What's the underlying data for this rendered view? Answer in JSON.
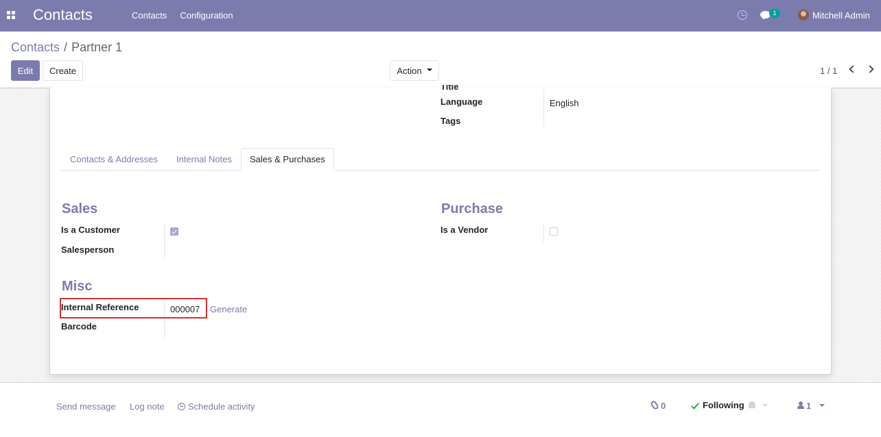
{
  "app": {
    "title": "Contacts"
  },
  "nav": {
    "menu": [
      "Contacts",
      "Configuration"
    ],
    "chat_badge": "1",
    "user_name": "Mitchell Admin"
  },
  "breadcrumb": {
    "parent": "Contacts",
    "separator": "/",
    "current": "Partner 1"
  },
  "toolbar": {
    "edit_label": "Edit",
    "create_label": "Create",
    "action_label": "Action"
  },
  "pager": {
    "value": "1 / 1"
  },
  "top_fields": [
    {
      "label": "Title",
      "value": ""
    },
    {
      "label": "Language",
      "value": "English"
    },
    {
      "label": "Tags",
      "value": ""
    }
  ],
  "tabs": [
    {
      "label": "Contacts & Addresses",
      "active": false
    },
    {
      "label": "Internal Notes",
      "active": false
    },
    {
      "label": "Sales & Purchases",
      "active": true
    }
  ],
  "sales": {
    "title": "Sales",
    "is_customer_label": "Is a Customer",
    "is_customer": true,
    "salesperson_label": "Salesperson",
    "salesperson": ""
  },
  "purchase": {
    "title": "Purchase",
    "is_vendor_label": "Is a Vendor",
    "is_vendor": false
  },
  "misc": {
    "title": "Misc",
    "internal_ref_label": "Internal Reference",
    "internal_ref": "000007",
    "generate_label": "Generate",
    "barcode_label": "Barcode",
    "barcode": ""
  },
  "chatter": {
    "send_message": "Send message",
    "log_note": "Log note",
    "schedule_activity": "Schedule activity",
    "attachments_count": "0",
    "following_label": "Following",
    "followers_count": "1"
  },
  "colors": {
    "brand": "#7c7bad",
    "badge": "#00a09d",
    "highlight": "#d32f2f",
    "following_check": "#28a745"
  }
}
